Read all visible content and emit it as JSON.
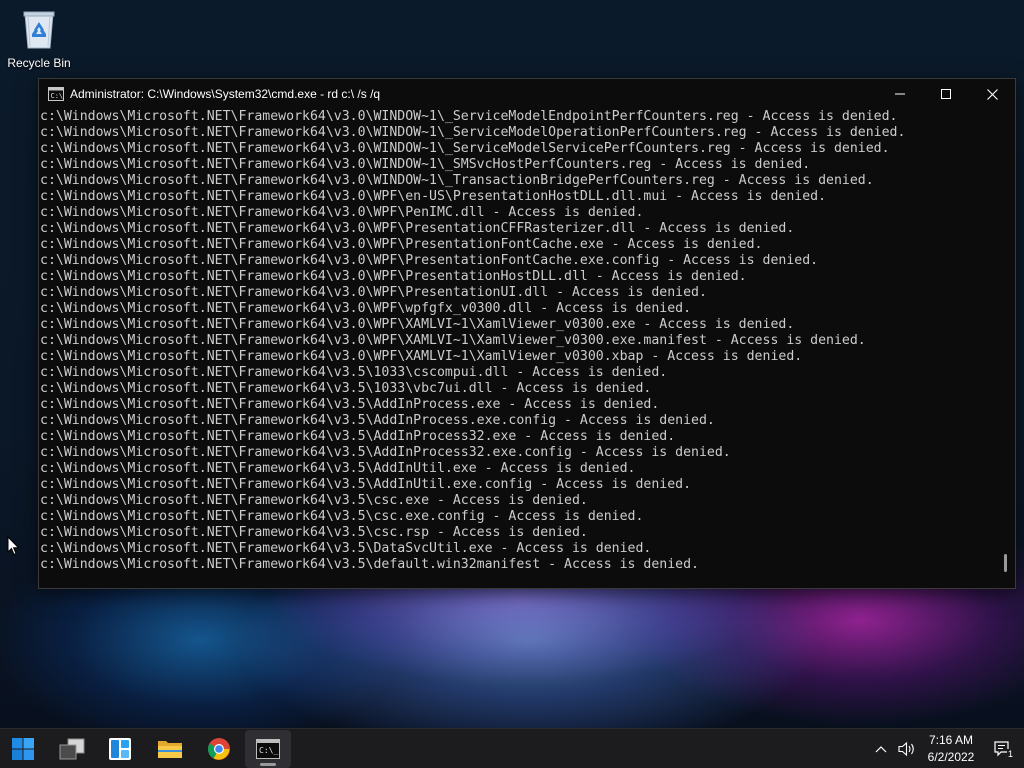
{
  "desktop": {
    "recycle_bin_label": "Recycle Bin"
  },
  "window": {
    "title": "Administrator: C:\\Windows\\System32\\cmd.exe - rd  c:\\ /s /q",
    "lines": [
      "c:\\Windows\\Microsoft.NET\\Framework64\\v3.0\\WINDOW~1\\_ServiceModelEndpointPerfCounters.reg - Access is denied.",
      "c:\\Windows\\Microsoft.NET\\Framework64\\v3.0\\WINDOW~1\\_ServiceModelOperationPerfCounters.reg - Access is denied.",
      "c:\\Windows\\Microsoft.NET\\Framework64\\v3.0\\WINDOW~1\\_ServiceModelServicePerfCounters.reg - Access is denied.",
      "c:\\Windows\\Microsoft.NET\\Framework64\\v3.0\\WINDOW~1\\_SMSvcHostPerfCounters.reg - Access is denied.",
      "c:\\Windows\\Microsoft.NET\\Framework64\\v3.0\\WINDOW~1\\_TransactionBridgePerfCounters.reg - Access is denied.",
      "c:\\Windows\\Microsoft.NET\\Framework64\\v3.0\\WPF\\en-US\\PresentationHostDLL.dll.mui - Access is denied.",
      "c:\\Windows\\Microsoft.NET\\Framework64\\v3.0\\WPF\\PenIMC.dll - Access is denied.",
      "c:\\Windows\\Microsoft.NET\\Framework64\\v3.0\\WPF\\PresentationCFFRasterizer.dll - Access is denied.",
      "c:\\Windows\\Microsoft.NET\\Framework64\\v3.0\\WPF\\PresentationFontCache.exe - Access is denied.",
      "c:\\Windows\\Microsoft.NET\\Framework64\\v3.0\\WPF\\PresentationFontCache.exe.config - Access is denied.",
      "c:\\Windows\\Microsoft.NET\\Framework64\\v3.0\\WPF\\PresentationHostDLL.dll - Access is denied.",
      "c:\\Windows\\Microsoft.NET\\Framework64\\v3.0\\WPF\\PresentationUI.dll - Access is denied.",
      "c:\\Windows\\Microsoft.NET\\Framework64\\v3.0\\WPF\\wpfgfx_v0300.dll - Access is denied.",
      "c:\\Windows\\Microsoft.NET\\Framework64\\v3.0\\WPF\\XAMLVI~1\\XamlViewer_v0300.exe - Access is denied.",
      "c:\\Windows\\Microsoft.NET\\Framework64\\v3.0\\WPF\\XAMLVI~1\\XamlViewer_v0300.exe.manifest - Access is denied.",
      "c:\\Windows\\Microsoft.NET\\Framework64\\v3.0\\WPF\\XAMLVI~1\\XamlViewer_v0300.xbap - Access is denied.",
      "c:\\Windows\\Microsoft.NET\\Framework64\\v3.5\\1033\\cscompui.dll - Access is denied.",
      "c:\\Windows\\Microsoft.NET\\Framework64\\v3.5\\1033\\vbc7ui.dll - Access is denied.",
      "c:\\Windows\\Microsoft.NET\\Framework64\\v3.5\\AddInProcess.exe - Access is denied.",
      "c:\\Windows\\Microsoft.NET\\Framework64\\v3.5\\AddInProcess.exe.config - Access is denied.",
      "c:\\Windows\\Microsoft.NET\\Framework64\\v3.5\\AddInProcess32.exe - Access is denied.",
      "c:\\Windows\\Microsoft.NET\\Framework64\\v3.5\\AddInProcess32.exe.config - Access is denied.",
      "c:\\Windows\\Microsoft.NET\\Framework64\\v3.5\\AddInUtil.exe - Access is denied.",
      "c:\\Windows\\Microsoft.NET\\Framework64\\v3.5\\AddInUtil.exe.config - Access is denied.",
      "c:\\Windows\\Microsoft.NET\\Framework64\\v3.5\\csc.exe - Access is denied.",
      "c:\\Windows\\Microsoft.NET\\Framework64\\v3.5\\csc.exe.config - Access is denied.",
      "c:\\Windows\\Microsoft.NET\\Framework64\\v3.5\\csc.rsp - Access is denied.",
      "c:\\Windows\\Microsoft.NET\\Framework64\\v3.5\\DataSvcUtil.exe - Access is denied.",
      "c:\\Windows\\Microsoft.NET\\Framework64\\v3.5\\default.win32manifest - Access is denied."
    ]
  },
  "taskbar": {
    "items": [
      {
        "icon": "start-icon"
      },
      {
        "icon": "task-view-icon"
      },
      {
        "icon": "widgets-icon"
      },
      {
        "icon": "file-explorer-icon"
      },
      {
        "icon": "chrome-icon"
      },
      {
        "icon": "command-prompt-icon",
        "active": true
      }
    ],
    "tray": {
      "icons": [
        "chevron-up-icon",
        "speaker-icon",
        "notification-icon"
      ],
      "time": "7:16 AM",
      "date": "6/2/2022",
      "notification_count": "1"
    }
  },
  "colors": {
    "console_bg": "#0c0c0c",
    "console_text": "#cccccc",
    "taskbar_bg": "#1c1c1f",
    "start_blue": "#1e8ce6"
  }
}
